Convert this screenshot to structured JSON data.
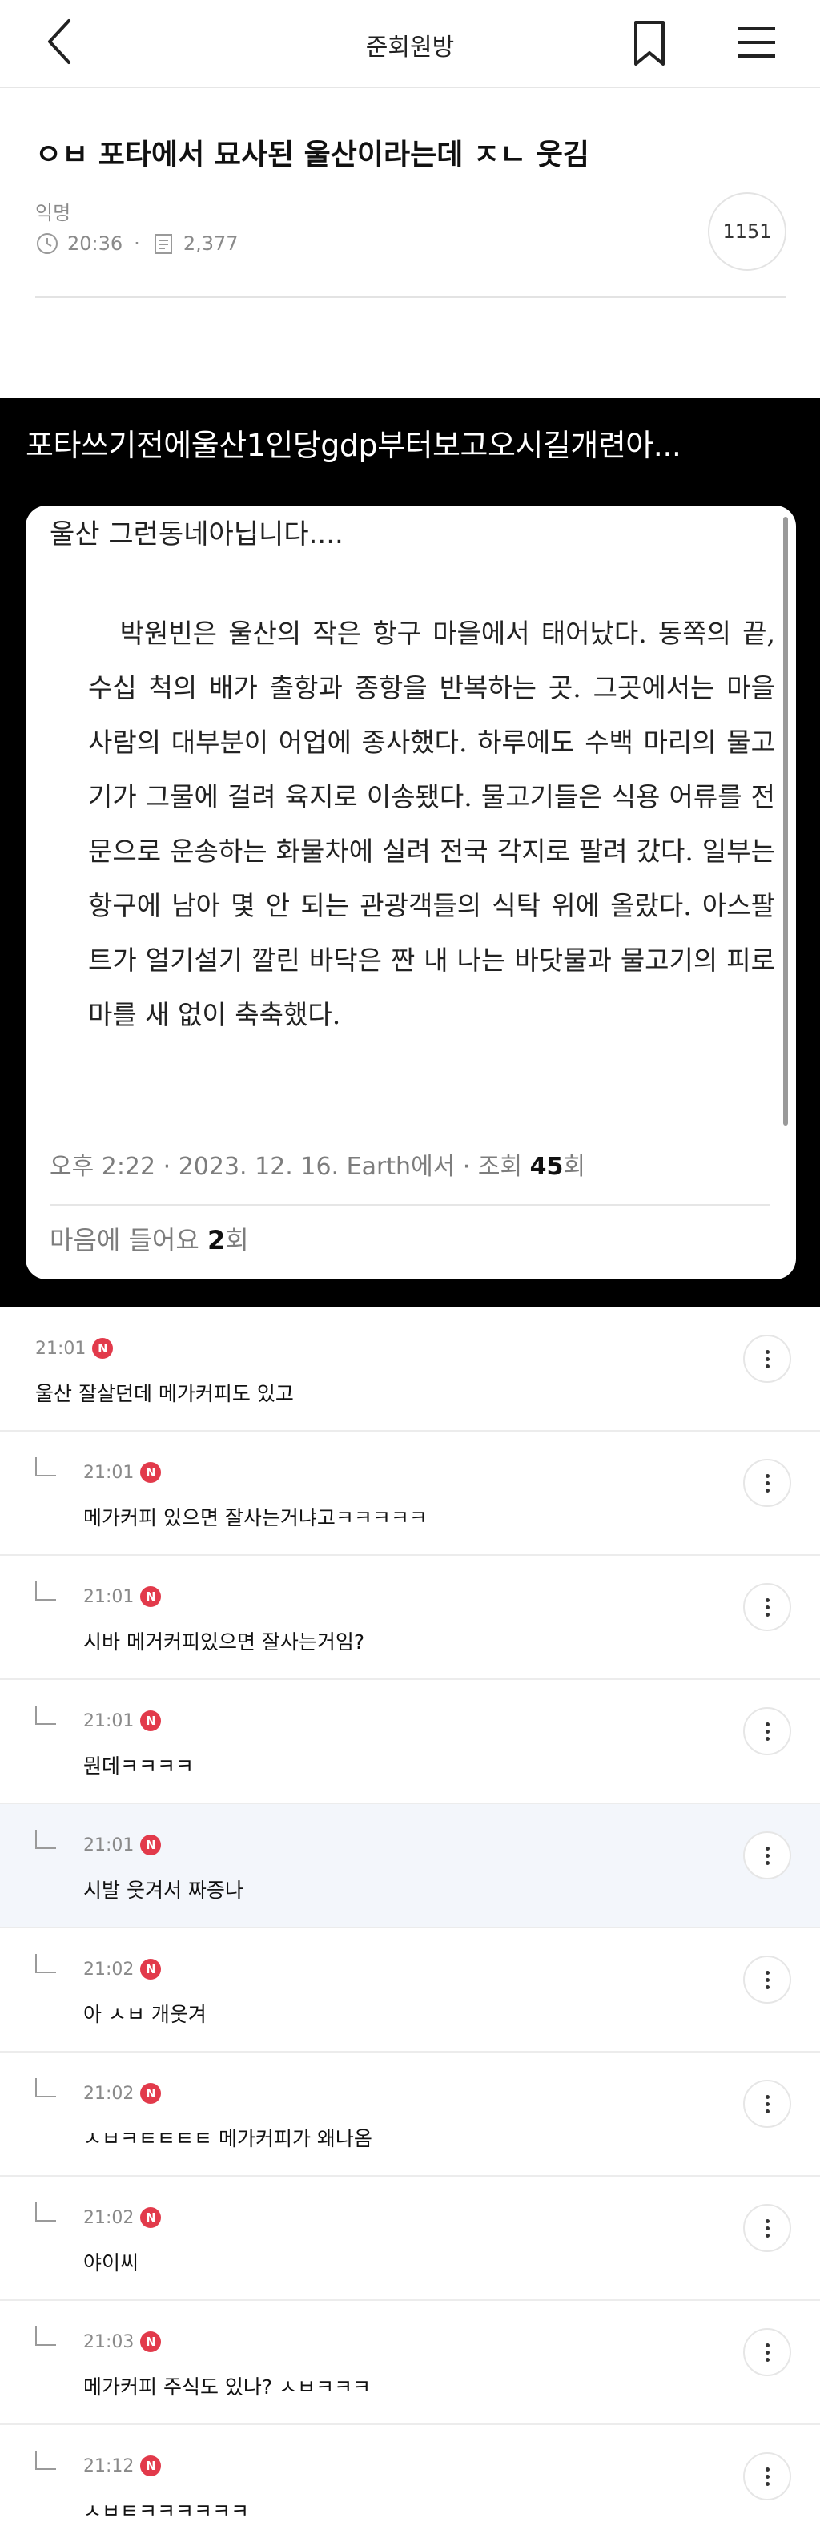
{
  "header": {
    "board_title": "준회원방"
  },
  "post": {
    "title": "ㅇㅂ 포타에서 묘사된 울산이라는데 ㅈㄴ 웃김",
    "author": "익명",
    "time": "20:36",
    "views": "2,377",
    "comment_count": "1151"
  },
  "embed": {
    "overlay_text": "포타쓰기전에울산1인당gdp부터보고오시길개련아...",
    "card_heading": "울산 그런동네아닙니다....",
    "body": "박원빈은 울산의 작은 항구 마을에서 태어났다. 동쪽의 끝, 수십 척의 배가 출항과 종항을 반복하는 곳. 그곳에서는 마을 사람의 대부분이 어업에 종사했다. 하루에도 수백 마리의 물고기가 그물에 걸려 육지로 이송됐다. 물고기들은 식용 어류를 전문으로 운송하는 화물차에 실려 전국 각지로 팔려 갔다. 일부는 항구에 남아 몇 안 되는 관광객들의 식탁 위에 올랐다. 아스팔트가 얼기설기 깔린 바닥은 짠 내 나는 바닷물과 물고기의 피로 마를 새 없이 축축했다.",
    "footer_prefix": "오후 2:22 · 2023. 12. 16. Earth에서 · 조회 ",
    "footer_views": "45",
    "footer_suffix": "회",
    "likes_prefix": "마음에 들어요 ",
    "likes_count": "2",
    "likes_suffix": "회"
  },
  "comments": [
    {
      "time": "21:01",
      "badge": "N",
      "text": "울산 잘살던데 메가커피도 있고",
      "reply": false
    },
    {
      "time": "21:01",
      "badge": "N",
      "text": "메가커피 있으면 잘사는거냐고ㅋㅋㅋㅋㅋ",
      "reply": true
    },
    {
      "time": "21:01",
      "badge": "N",
      "text": "시바 메거커피있으면 잘사는거임?",
      "reply": true
    },
    {
      "time": "21:01",
      "badge": "N",
      "text": "뭔데ㅋㅋㅋㅋ",
      "reply": true
    },
    {
      "time": "21:01",
      "badge": "N",
      "text": "시발 웃겨서 짜증나",
      "reply": true
    },
    {
      "time": "21:02",
      "badge": "N",
      "text": "아 ㅅㅂ 개웃겨",
      "reply": true
    },
    {
      "time": "21:02",
      "badge": "N",
      "text": "ㅅㅂㅋㅌㅌㅌㅌ 메가커피가 왜나옴",
      "reply": true
    },
    {
      "time": "21:02",
      "badge": "N",
      "text": "야이씨",
      "reply": true
    },
    {
      "time": "21:03",
      "badge": "N",
      "text": "메가커피 주식도 있나? ㅅㅂㅋㅋㅋ",
      "reply": true
    },
    {
      "time": "21:12",
      "badge": "N",
      "text": "ㅅㅂㅌㅋㅋㅋㅋㅋㅋ",
      "reply": true
    }
  ]
}
